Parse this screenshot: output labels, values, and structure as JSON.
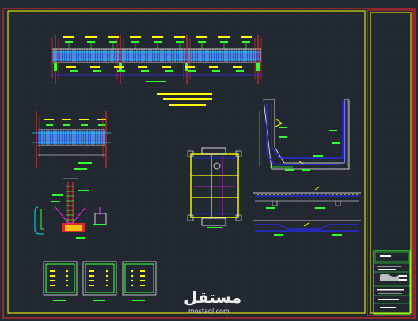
{
  "watermark": {
    "logo_text": "مستقل",
    "site": "mostaql.com"
  },
  "colors": {
    "background": "#212830",
    "grid": "#2b333b",
    "border_outer": "#ff2a2a",
    "border_inner": "#ffff00",
    "rebar_blue": "#2a2aff",
    "section_fill": "#1a6cff",
    "text_yellow": "#ffff00",
    "dim_green": "#33ff33",
    "red": "#ff3030",
    "cyan": "#00e5ff",
    "magenta": "#ff2bff",
    "white": "#ffffff",
    "white_dim": "#d8d8d8"
  },
  "drawing": {
    "views": [
      "beam-elevation",
      "short-beam-elevation",
      "footing-section",
      "column-sections",
      "slab-plan",
      "wall-section",
      "beam-rebar-details",
      "title-block"
    ]
  }
}
